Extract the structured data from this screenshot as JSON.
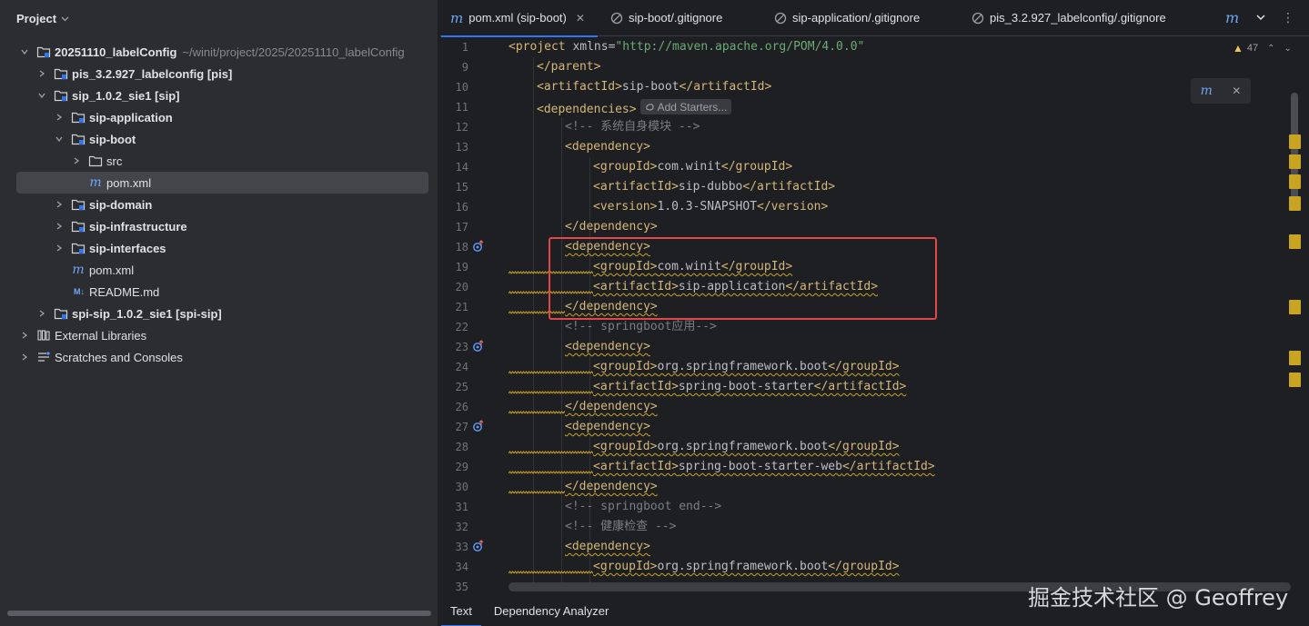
{
  "project_panel": {
    "title": "Project",
    "tree": [
      {
        "label": "20251110_labelConfig",
        "hint": "~/winit/project/2025/20251110_labelConfig",
        "bold": true,
        "expanded": true,
        "icon": "module-folder-icon",
        "depth": 0
      },
      {
        "label": "pis_3.2.927_labelconfig [pis]",
        "bold": true,
        "expanded": false,
        "icon": "module-folder-icon",
        "depth": 1
      },
      {
        "label": "sip_1.0.2_sie1 [sip]",
        "bold": true,
        "expanded": true,
        "icon": "module-folder-icon",
        "depth": 1
      },
      {
        "label": "sip-application",
        "bold": true,
        "expanded": false,
        "icon": "module-folder-icon",
        "depth": 2
      },
      {
        "label": "sip-boot",
        "bold": true,
        "expanded": true,
        "icon": "module-folder-icon",
        "depth": 2
      },
      {
        "label": "src",
        "bold": false,
        "expanded": false,
        "icon": "folder-icon",
        "depth": 3
      },
      {
        "label": "pom.xml",
        "bold": false,
        "icon": "maven-icon",
        "depth": 3,
        "selected": true
      },
      {
        "label": "sip-domain",
        "bold": true,
        "expanded": false,
        "icon": "module-folder-icon",
        "depth": 2
      },
      {
        "label": "sip-infrastructure",
        "bold": true,
        "expanded": false,
        "icon": "module-folder-icon",
        "depth": 2
      },
      {
        "label": "sip-interfaces",
        "bold": true,
        "expanded": false,
        "icon": "module-folder-icon",
        "depth": 2
      },
      {
        "label": "pom.xml",
        "bold": false,
        "icon": "maven-icon",
        "depth": 2
      },
      {
        "label": "README.md",
        "bold": false,
        "icon": "markdown-icon",
        "depth": 2
      },
      {
        "label": "spi-sip_1.0.2_sie1 [spi-sip]",
        "bold": true,
        "expanded": false,
        "icon": "module-folder-icon",
        "depth": 1
      },
      {
        "label": "External Libraries",
        "bold": false,
        "expanded": false,
        "icon": "library-icon",
        "depth": 0
      },
      {
        "label": "Scratches and Consoles",
        "bold": false,
        "expanded": false,
        "icon": "scratches-icon",
        "depth": 0
      }
    ]
  },
  "tabs": [
    {
      "label": "pom.xml (sip-boot)",
      "icon": "maven-icon",
      "active": true
    },
    {
      "label": "sip-boot/.gitignore",
      "icon": "gitignore-icon",
      "active": false
    },
    {
      "label": "sip-application/.gitignore",
      "icon": "gitignore-icon",
      "active": false
    },
    {
      "label": "pis_3.2.927_labelconfig/.gitignore",
      "icon": "gitignore-icon",
      "active": false
    }
  ],
  "editor": {
    "warning_count": "47",
    "inlay_hint": "Add Starters...",
    "lines": [
      {
        "n": "1",
        "indent": 0,
        "kind": "project",
        "text": "<project xmlns=\"http://maven.apache.org/POM/4.0.0\""
      },
      {
        "n": "9",
        "indent": 1,
        "kind": "tag",
        "text": "</parent>"
      },
      {
        "n": "10",
        "indent": 1,
        "kind": "tag",
        "text": "<artifactId>sip-boot</artifactId>"
      },
      {
        "n": "11",
        "indent": 1,
        "kind": "tag",
        "text": "<dependencies>",
        "inlay": true
      },
      {
        "n": "12",
        "indent": 2,
        "kind": "comment",
        "text": "<!-- 系统自身模块 -->"
      },
      {
        "n": "13",
        "indent": 2,
        "kind": "tag",
        "text": "<dependency>"
      },
      {
        "n": "14",
        "indent": 3,
        "kind": "tag",
        "text": "<groupId>com.winit</groupId>"
      },
      {
        "n": "15",
        "indent": 3,
        "kind": "tag",
        "text": "<artifactId>sip-dubbo</artifactId>"
      },
      {
        "n": "16",
        "indent": 3,
        "kind": "tag",
        "text": "<version>1.0.3-SNAPSHOT</version>"
      },
      {
        "n": "17",
        "indent": 2,
        "kind": "tag",
        "text": "</dependency>"
      },
      {
        "n": "18",
        "indent": 2,
        "kind": "tag",
        "text": "<dependency>",
        "warn": true,
        "gutter": true
      },
      {
        "n": "19",
        "indent": 3,
        "kind": "tag",
        "text": "<groupId>com.winit</groupId>",
        "warn": true,
        "squig": true
      },
      {
        "n": "20",
        "indent": 3,
        "kind": "tag",
        "text": "<artifactId>sip-application</artifactId>",
        "warn": true,
        "squig": true
      },
      {
        "n": "21",
        "indent": 2,
        "kind": "tag",
        "text": "</dependency>",
        "warn": true,
        "squig": true
      },
      {
        "n": "22",
        "indent": 2,
        "kind": "comment",
        "text": "<!-- springboot应用-->"
      },
      {
        "n": "23",
        "indent": 2,
        "kind": "tag",
        "text": "<dependency>",
        "warn": true,
        "gutter": true
      },
      {
        "n": "24",
        "indent": 3,
        "kind": "tag",
        "text": "<groupId>org.springframework.boot</groupId>",
        "warn": true,
        "squig": true
      },
      {
        "n": "25",
        "indent": 3,
        "kind": "tag",
        "text": "<artifactId>spring-boot-starter</artifactId>",
        "warn": true,
        "squig": true
      },
      {
        "n": "26",
        "indent": 2,
        "kind": "tag",
        "text": "</dependency>",
        "warn": true,
        "squig": true
      },
      {
        "n": "27",
        "indent": 2,
        "kind": "tag",
        "text": "<dependency>",
        "warn": true,
        "gutter": true
      },
      {
        "n": "28",
        "indent": 3,
        "kind": "tag",
        "text": "<groupId>org.springframework.boot</groupId>",
        "warn": true,
        "squig": true
      },
      {
        "n": "29",
        "indent": 3,
        "kind": "tag",
        "text": "<artifactId>spring-boot-starter-web</artifactId>",
        "warn": true,
        "squig": true
      },
      {
        "n": "30",
        "indent": 2,
        "kind": "tag",
        "text": "</dependency>",
        "warn": true,
        "squig": true
      },
      {
        "n": "31",
        "indent": 2,
        "kind": "comment",
        "text": "<!-- springboot end-->"
      },
      {
        "n": "32",
        "indent": 2,
        "kind": "comment",
        "text": "<!-- 健康检查 -->"
      },
      {
        "n": "33",
        "indent": 2,
        "kind": "tag",
        "text": "<dependency>",
        "warn": true,
        "gutter": true
      },
      {
        "n": "34",
        "indent": 3,
        "kind": "tag",
        "text": "<groupId>org.springframework.boot</groupId>",
        "warn": true,
        "squig": true
      },
      {
        "n": "35",
        "indent": 2,
        "kind": "tag",
        "text": ""
      }
    ]
  },
  "bottom_tabs": [
    {
      "label": "Text",
      "active": true
    },
    {
      "label": "Dependency Analyzer",
      "active": false
    }
  ],
  "watermark": "掘金技术社区 @ Geoffrey",
  "colors": {
    "accent": "#3574f0",
    "tag": "#d5b778",
    "string": "#6aab73",
    "comment": "#7a7e85",
    "warning": "#c9a322",
    "highlight_box": "#e0474b"
  }
}
